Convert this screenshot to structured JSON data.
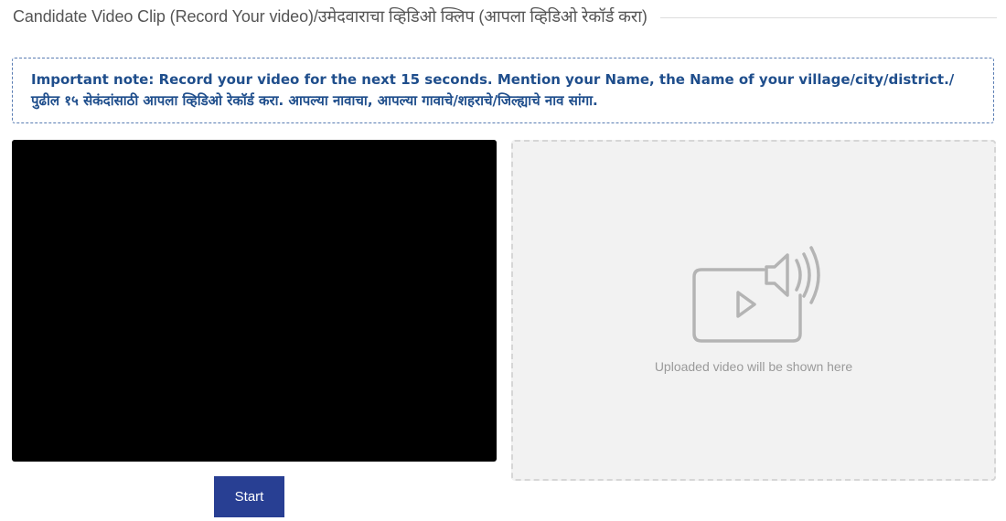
{
  "section": {
    "title": "Candidate Video Clip (Record Your video)/उमेदवाराचा व्हिडिओ क्लिप (आपला व्हिडिओ रेकॉर्ड करा)"
  },
  "note": {
    "text": "Important note: Record your video for the next 15 seconds. Mention your Name, the Name of your village/city/district./पुढील १५ सेकंदांसाठी आपला व्हिडिओ रेकॉर्ड करा. आपल्या नावाचा, आपल्या गावाचे/शहराचे/जिल्ह्याचे नाव सांगा."
  },
  "recorder": {
    "start_label": "Start"
  },
  "upload": {
    "placeholder_text": "Uploaded video will be shown here",
    "icon": "video-speaker-icon"
  },
  "colors": {
    "note_text": "#1f4e8c",
    "note_border": "#5a7db3",
    "button_bg": "#283f93",
    "preview_bg": "#000000",
    "upload_bg": "#f2f2f2",
    "icon_stroke": "#b4b4b4"
  }
}
